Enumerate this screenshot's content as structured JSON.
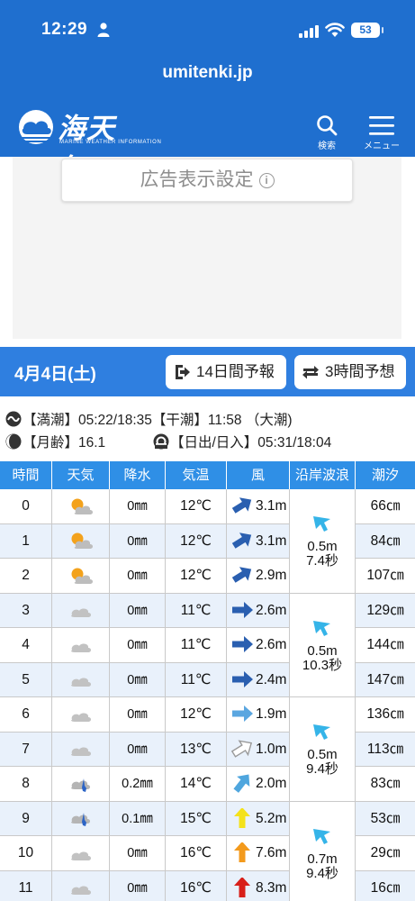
{
  "status_bar": {
    "time": "12:29",
    "battery": "53"
  },
  "browser": {
    "url": "umitenki.jp"
  },
  "header": {
    "logo_text": "海天気.JP",
    "logo_subtext": "MARINE WEATHER INFORMATION",
    "search_label": "検索",
    "menu_label": "メニュー"
  },
  "ad": {
    "settings_label": "広告表示設定",
    "info_glyph": "i"
  },
  "date_bar": {
    "date": "4月4日(土)",
    "btn_14day": "14日間予報",
    "btn_3hour": "3時間予想"
  },
  "tide_info": {
    "line1": "【満潮】05:22/18:35【干潮】11:58 （大潮)",
    "moon_age": "【月齢】16.1",
    "sun": "【日出/日入】05:31/18:04"
  },
  "table": {
    "headers": [
      "時間",
      "天気",
      "降水",
      "気温",
      "風",
      "沿岸波浪",
      "潮汐"
    ],
    "rows": [
      {
        "hour": "0",
        "weather": "partly-cloudy",
        "rain": "0㎜",
        "temp": "12℃",
        "wind_dir": "NE",
        "wind_color": "#2a5fb0",
        "wind": "3.1m",
        "tide": "66㎝"
      },
      {
        "hour": "1",
        "weather": "partly-cloudy",
        "rain": "0㎜",
        "temp": "12℃",
        "wind_dir": "NE",
        "wind_color": "#2a5fb0",
        "wind": "3.1m",
        "tide": "84㎝"
      },
      {
        "hour": "2",
        "weather": "partly-cloudy",
        "rain": "0㎜",
        "temp": "12℃",
        "wind_dir": "NE",
        "wind_color": "#2a5fb0",
        "wind": "2.9m",
        "tide": "107㎝"
      },
      {
        "hour": "3",
        "weather": "cloudy",
        "rain": "0㎜",
        "temp": "11℃",
        "wind_dir": "E",
        "wind_color": "#2a5fb0",
        "wind": "2.6m",
        "tide": "129㎝"
      },
      {
        "hour": "4",
        "weather": "cloudy",
        "rain": "0㎜",
        "temp": "11℃",
        "wind_dir": "E",
        "wind_color": "#2a5fb0",
        "wind": "2.6m",
        "tide": "144㎝"
      },
      {
        "hour": "5",
        "weather": "cloudy",
        "rain": "0㎜",
        "temp": "11℃",
        "wind_dir": "E",
        "wind_color": "#2a5fb0",
        "wind": "2.4m",
        "tide": "147㎝"
      },
      {
        "hour": "6",
        "weather": "cloudy",
        "rain": "0㎜",
        "temp": "12℃",
        "wind_dir": "E",
        "wind_color": "#5aa6e0",
        "wind": "1.9m",
        "tide": "136㎝"
      },
      {
        "hour": "7",
        "weather": "cloudy",
        "rain": "0㎜",
        "temp": "13℃",
        "wind_dir": "NE",
        "wind_color": "#ffffff",
        "wind": "1.0m",
        "tide": "113㎝"
      },
      {
        "hour": "8",
        "weather": "rain-cloud",
        "rain": "0.2㎜",
        "temp": "14℃",
        "wind_dir": "NE-steep",
        "wind_color": "#4fa6de",
        "wind": "2.0m",
        "tide": "83㎝"
      },
      {
        "hour": "9",
        "weather": "rain-cloud",
        "rain": "0.1㎜",
        "temp": "15℃",
        "wind_dir": "N",
        "wind_color": "#f4e21a",
        "wind": "5.2m",
        "tide": "53㎝"
      },
      {
        "hour": "10",
        "weather": "cloudy",
        "rain": "0㎜",
        "temp": "16℃",
        "wind_dir": "N",
        "wind_color": "#f39a1c",
        "wind": "7.6m",
        "tide": "29㎝"
      },
      {
        "hour": "11",
        "weather": "cloudy",
        "rain": "0㎜",
        "temp": "16℃",
        "wind_dir": "N",
        "wind_color": "#d8201a",
        "wind": "8.3m",
        "tide": "16㎝"
      }
    ],
    "waves": [
      {
        "height": "0.5m",
        "period": "7.4秒"
      },
      {
        "height": "0.5m",
        "period": "10.3秒"
      },
      {
        "height": "0.5m",
        "period": "9.4秒"
      },
      {
        "height": "0.7m",
        "period": "9.4秒"
      }
    ]
  },
  "colors": {
    "header_blue": "#1f6fcf",
    "date_bar_blue": "#2f7fe0",
    "table_header_blue": "#2f8fe6",
    "row_alt": "#e9f1fb",
    "wave_arrow": "#35b4e8"
  }
}
